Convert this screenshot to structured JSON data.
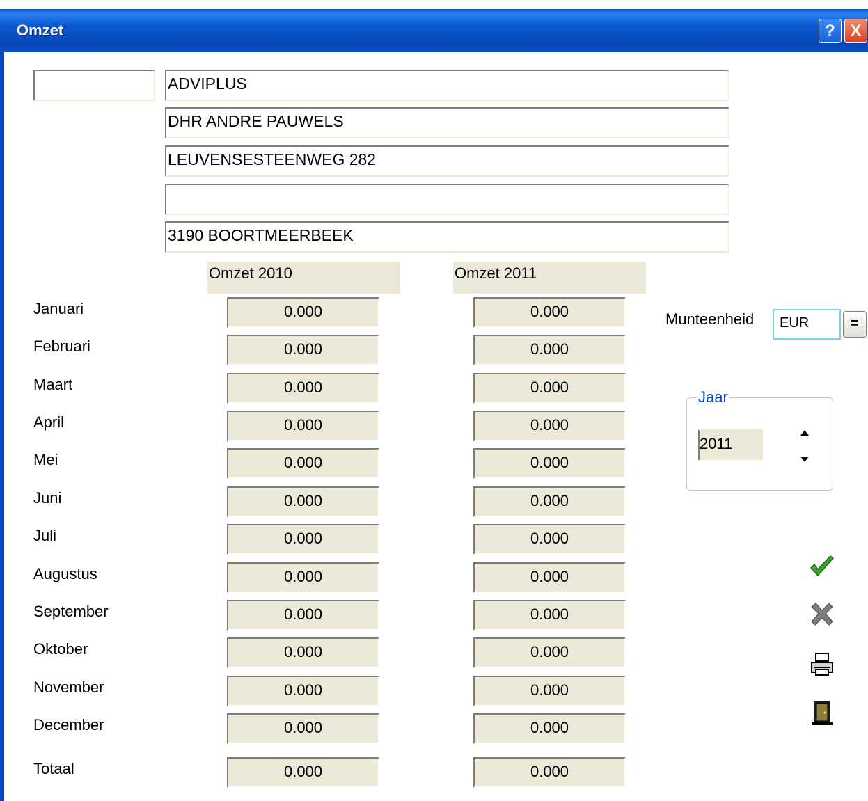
{
  "window": {
    "title": "Omzet",
    "help_glyph": "?",
    "close_glyph": "X"
  },
  "address": {
    "code": "",
    "lines": [
      "ADVIPLUS",
      "DHR ANDRE PAUWELS",
      "LEUVENSESTEENWEG 282",
      "",
      "3190 BOORTMEERBEEK"
    ]
  },
  "columns": {
    "col1": "Omzet 2010",
    "col2": "Omzet 2011"
  },
  "months": [
    {
      "label": "Januari",
      "v2010": "0.000",
      "v2011": "0.000"
    },
    {
      "label": "Februari",
      "v2010": "0.000",
      "v2011": "0.000"
    },
    {
      "label": "Maart",
      "v2010": "0.000",
      "v2011": "0.000"
    },
    {
      "label": "April",
      "v2010": "0.000",
      "v2011": "0.000"
    },
    {
      "label": "Mei",
      "v2010": "0.000",
      "v2011": "0.000"
    },
    {
      "label": "Juni",
      "v2010": "0.000",
      "v2011": "0.000"
    },
    {
      "label": "Juli",
      "v2010": "0.000",
      "v2011": "0.000"
    },
    {
      "label": "Augustus",
      "v2010": "0.000",
      "v2011": "0.000"
    },
    {
      "label": "September",
      "v2010": "0.000",
      "v2011": "0.000"
    },
    {
      "label": "Oktober",
      "v2010": "0.000",
      "v2011": "0.000"
    },
    {
      "label": "November",
      "v2010": "0.000",
      "v2011": "0.000"
    },
    {
      "label": "December",
      "v2010": "0.000",
      "v2011": "0.000"
    }
  ],
  "total": {
    "label": "Totaal",
    "v2010": "0.000",
    "v2011": "0.000"
  },
  "currency": {
    "label": "Munteenheid",
    "value": "EUR",
    "button_label": "="
  },
  "year": {
    "legend": "Jaar",
    "value": "2011"
  },
  "icons": {
    "confirm": "checkmark-icon",
    "cancel": "cross-icon",
    "print": "printer-icon",
    "exit": "door-icon"
  },
  "colors": {
    "titlebar": "#0a5fd8",
    "field_bg": "#ece9d8",
    "accent": "#0046d5",
    "confirm": "#3aa52a"
  }
}
